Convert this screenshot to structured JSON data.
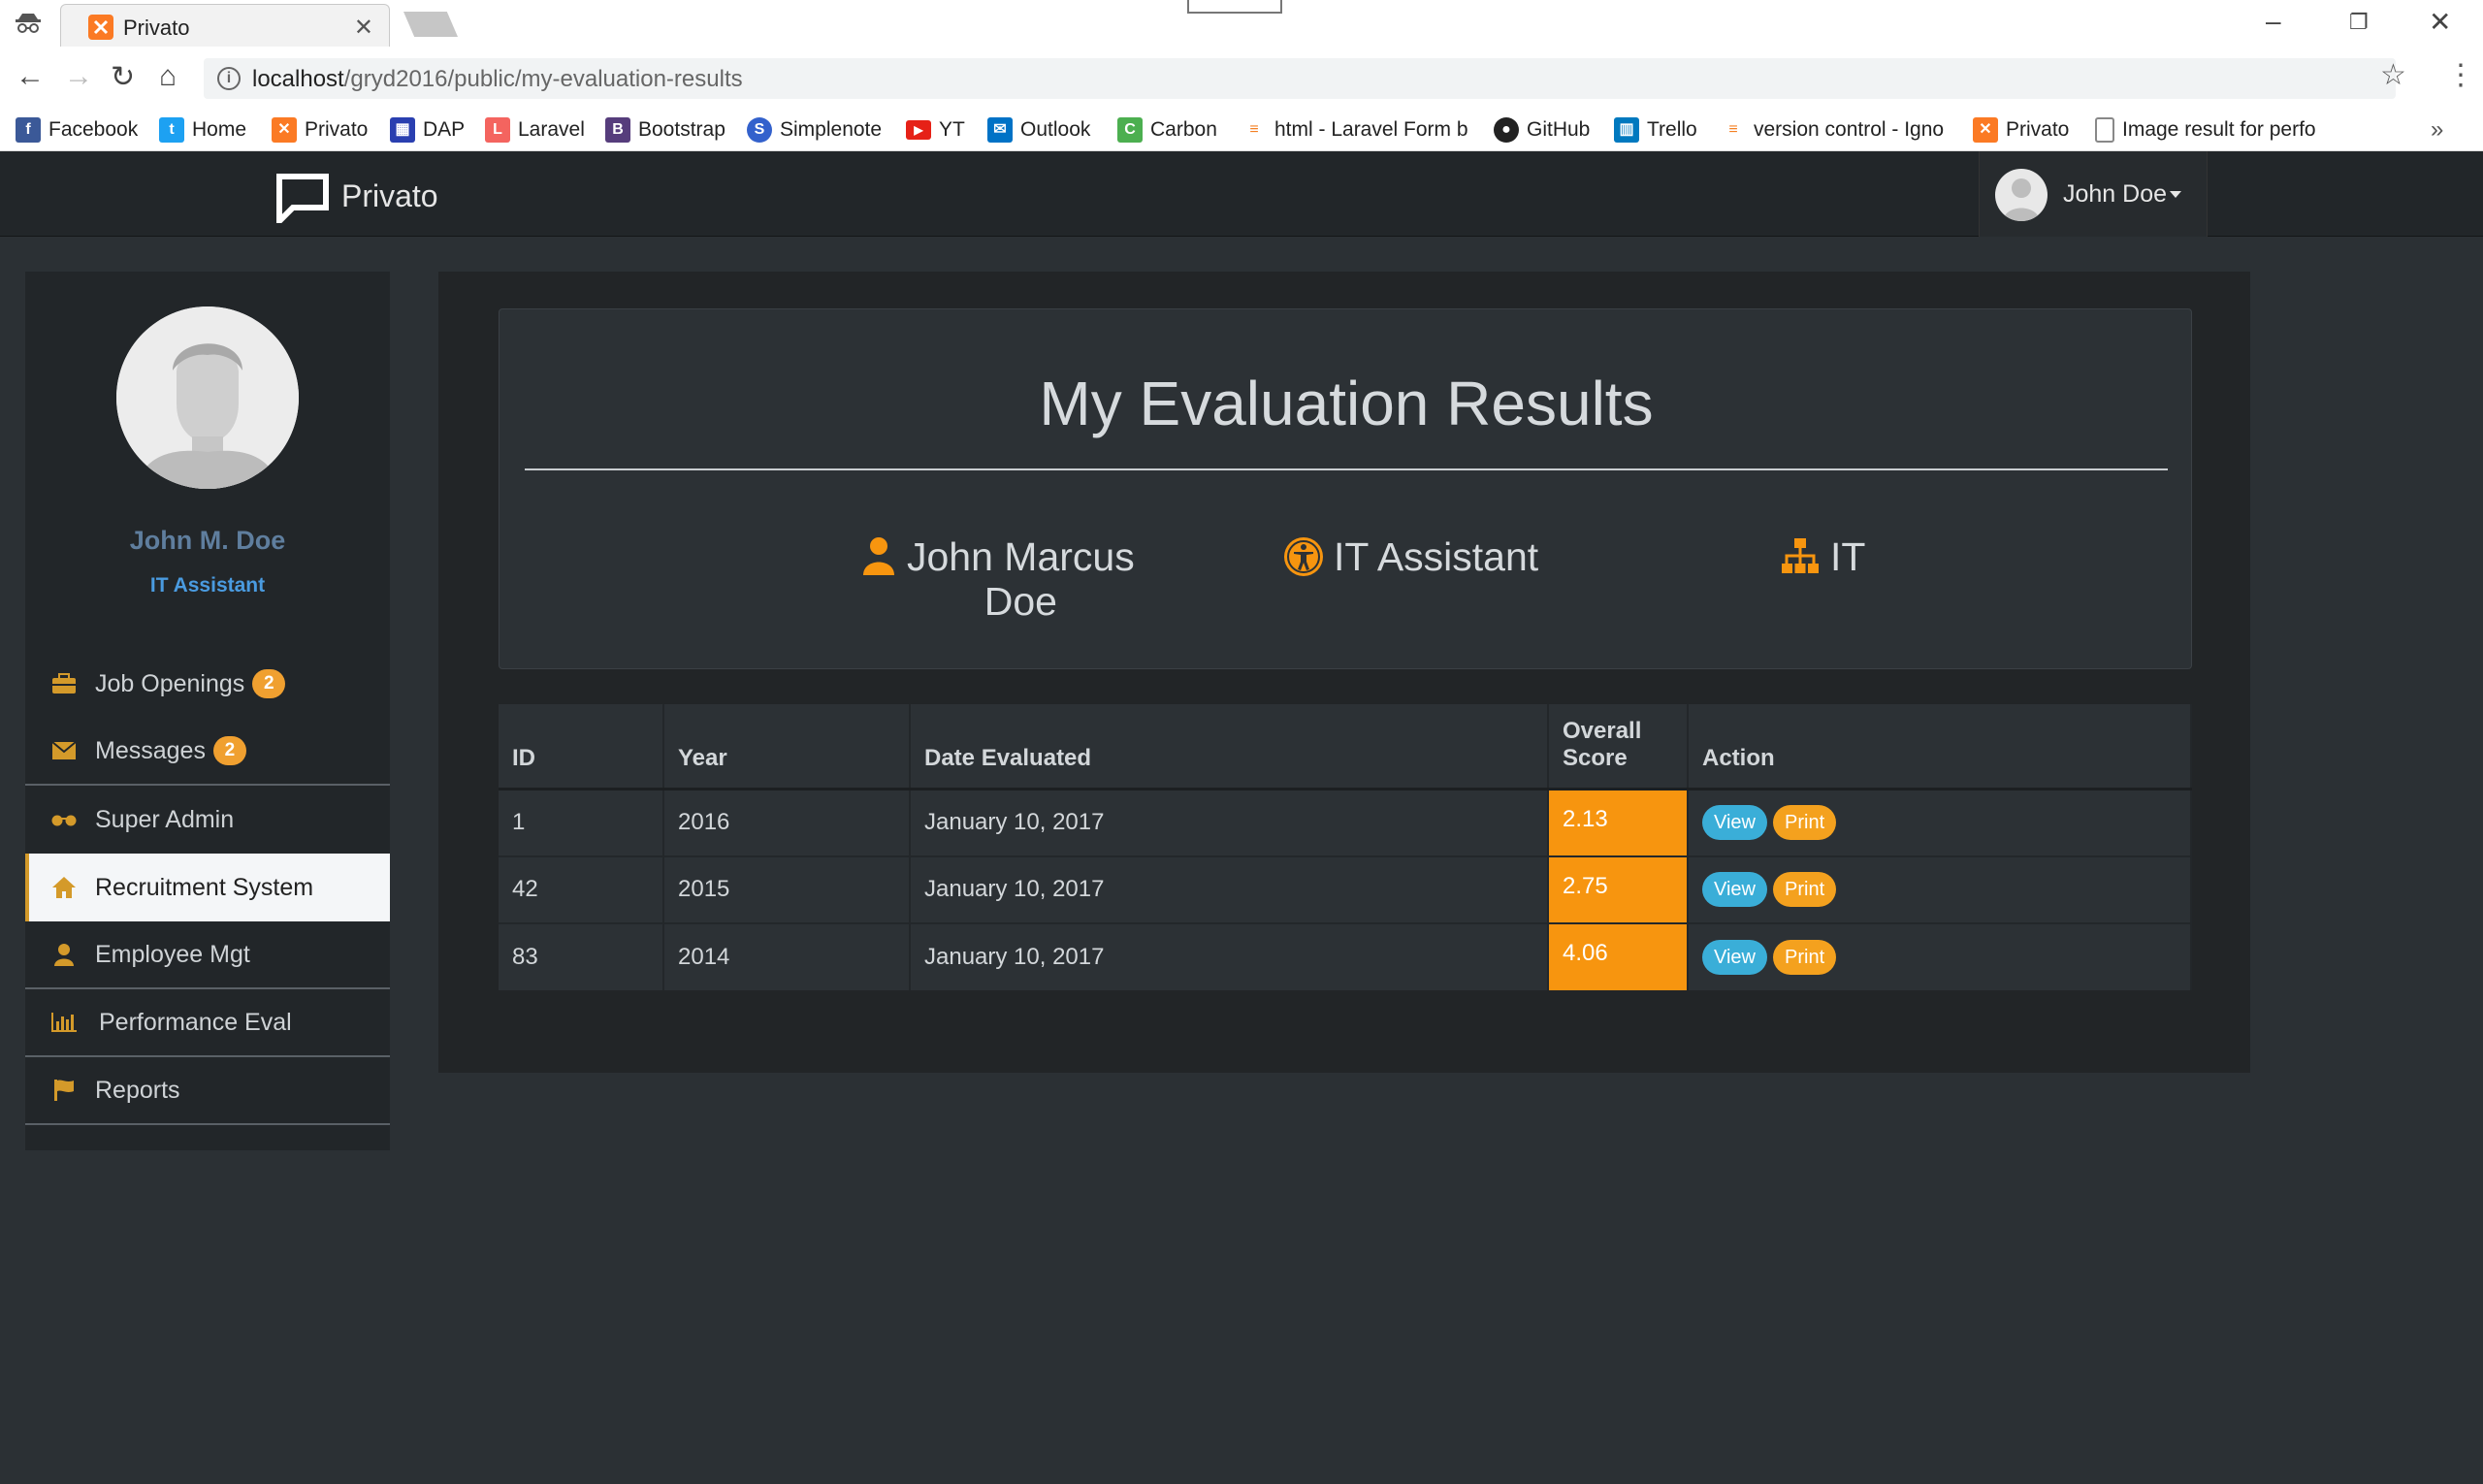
{
  "browser": {
    "tab_title": "Privato",
    "url_host": "localhost",
    "url_path": "/gryd2016/public/my-evaluation-results",
    "bookmarks": [
      {
        "label": "Facebook",
        "icon": "facebook-icon",
        "color": "#3b5998"
      },
      {
        "label": "Home",
        "icon": "twitter-icon",
        "color": "#1da1f2"
      },
      {
        "label": "Privato",
        "icon": "xampp-icon",
        "color": "#fb7a24"
      },
      {
        "label": "DAP",
        "icon": "dap-icon",
        "color": "#2a3fb0"
      },
      {
        "label": "Laravel",
        "icon": "laravel-icon",
        "color": "#f4645f"
      },
      {
        "label": "Bootstrap",
        "icon": "bootstrap-icon",
        "color": "#563d7c"
      },
      {
        "label": "Simplenote",
        "icon": "simplenote-icon",
        "color": "#3361cc"
      },
      {
        "label": "YT",
        "icon": "youtube-icon",
        "color": "#e62117"
      },
      {
        "label": "Outlook",
        "icon": "outlook-icon",
        "color": "#0072c6"
      },
      {
        "label": "Carbon",
        "icon": "carbon-icon",
        "color": "#4caf50"
      },
      {
        "label": "html - Laravel Form b",
        "icon": "stackoverflow-icon",
        "color": "#f48024"
      },
      {
        "label": "GitHub",
        "icon": "github-icon",
        "color": "#222222"
      },
      {
        "label": "Trello",
        "icon": "trello-icon",
        "color": "#0079bf"
      },
      {
        "label": "version control - Igno",
        "icon": "stackoverflow-icon",
        "color": "#f48024"
      },
      {
        "label": "Privato",
        "icon": "xampp-icon",
        "color": "#fb7a24"
      },
      {
        "label": "Image result for perfo",
        "icon": "page-icon",
        "color": "#888888"
      }
    ]
  },
  "navbar": {
    "brand": "Privato",
    "user_name": "John Doe"
  },
  "sidebar": {
    "profile_name": "John M. Doe",
    "profile_role": "IT Assistant",
    "items": [
      {
        "label": "Job Openings",
        "icon": "briefcase-icon",
        "badge": "2"
      },
      {
        "label": "Messages",
        "icon": "envelope-icon",
        "badge": "2"
      },
      {
        "label": "Super Admin",
        "icon": "glasses-icon"
      },
      {
        "label": "Recruitment System",
        "icon": "home-icon",
        "active": true
      },
      {
        "label": "Employee Mgt",
        "icon": "user-icon"
      },
      {
        "label": "Performance Eval",
        "icon": "bar-chart-icon"
      },
      {
        "label": "Reports",
        "icon": "flag-icon"
      }
    ]
  },
  "main": {
    "title": "My Evaluation Results",
    "employee_name": "John Marcus Doe",
    "employee_name_line1": "John Marcus",
    "employee_name_line2": "Doe",
    "position": "IT Assistant",
    "department": "IT",
    "table": {
      "headers": {
        "id": "ID",
        "year": "Year",
        "date": "Date Evaluated",
        "score_line1": "Overall",
        "score_line2": "Score",
        "action": "Action"
      },
      "rows": [
        {
          "id": "1",
          "year": "2016",
          "date": "January 10, 2017",
          "score": "2.13"
        },
        {
          "id": "42",
          "year": "2015",
          "date": "January 10, 2017",
          "score": "2.75"
        },
        {
          "id": "83",
          "year": "2014",
          "date": "January 10, 2017",
          "score": "4.06"
        }
      ],
      "view_label": "View",
      "print_label": "Print"
    }
  },
  "colors": {
    "accent_orange": "#f7950f",
    "icon_gold": "#d49a2a",
    "view_blue": "#3aaed8",
    "page_bg": "#2b3034"
  }
}
